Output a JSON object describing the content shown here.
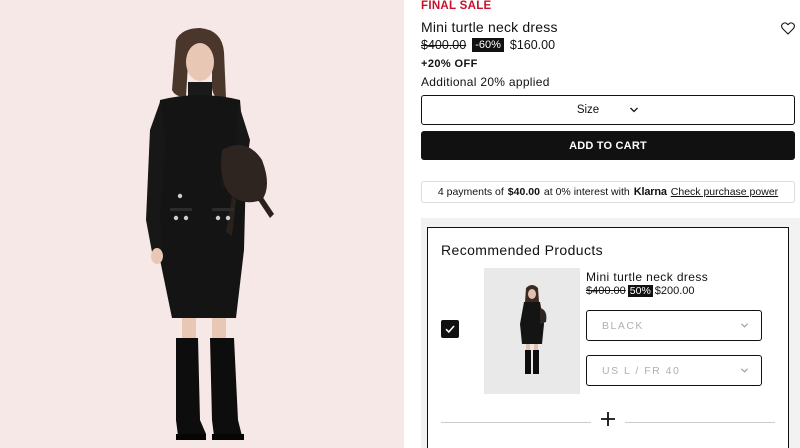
{
  "product": {
    "sale_tag": "FINAL SALE",
    "name": "Mini turtle neck dress",
    "old_price": "$400.00",
    "discount": "-60%",
    "new_price": "$160.00",
    "extra_off": "+20% OFF",
    "extra_applied": "Additional 20% applied"
  },
  "size_select": {
    "label": "Size"
  },
  "add_to_cart": {
    "label": "ADD TO CART"
  },
  "klarna": {
    "prefix": "4 payments of",
    "amount": "$40.00",
    "middle": "at 0% interest with",
    "brand": "Klarna",
    "link": "Check purchase power"
  },
  "recommended": {
    "title": "Recommended Products",
    "items": [
      {
        "name": "Mini turtle neck dress",
        "old_price": "$400.00",
        "discount": "50%",
        "new_price": "$200.00",
        "color_value": "BLACK",
        "size_value": "US L / FR 40",
        "checked": true
      }
    ]
  },
  "icons": [
    "heart-icon",
    "chevron-down-icon",
    "checkmark-icon",
    "plus-icon"
  ],
  "colors": {
    "sale": "#c8102e",
    "primary": "#111111",
    "photo_bg": "#f6e8e6"
  }
}
